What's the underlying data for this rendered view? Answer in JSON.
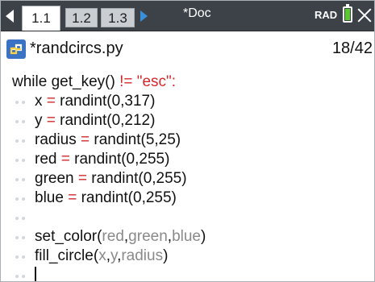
{
  "tabs": [
    {
      "label": "1.1",
      "active": true
    },
    {
      "label": "1.2",
      "active": false
    },
    {
      "label": "1.3",
      "active": false
    }
  ],
  "doc_title": "*Doc",
  "mode": "RAD",
  "file": {
    "name": "*randcircs.py",
    "position": "18/42"
  },
  "code": {
    "line1": {
      "kw": "while",
      "call": " get_key() ",
      "op": "!=",
      "str": " \"esc\":"
    },
    "line2": {
      "name": "x",
      "eq": " = ",
      "call": "randint(0,317)"
    },
    "line3": {
      "name": "y",
      "eq": " = ",
      "call": "randint(0,212)"
    },
    "line4": {
      "name": "radius",
      "eq": " = ",
      "call": "randint(5,25)"
    },
    "line5": {
      "name": "red",
      "eq": " = ",
      "call": "randint(0,255)"
    },
    "line6": {
      "name": "green",
      "eq": " = ",
      "call": "randint(0,255)"
    },
    "line7": {
      "name": "blue",
      "eq": " = ",
      "call": "randint(0,255)"
    },
    "line9": {
      "fn": "set_color(",
      "a": "red",
      "c1": ",",
      "b": "green",
      "c2": ",",
      "c": "blue",
      "end": ")"
    },
    "line10": {
      "fn": "fill_circle(",
      "a": "x",
      "c1": ",",
      "b": "y",
      "c2": ",",
      "c": "radius",
      "end": ")"
    }
  },
  "colors": {
    "topbar": "#3d4248",
    "string": "#d1282c",
    "variable_arg": "#8a8a8a",
    "battery": "#5cc934",
    "nav_arrow": "#3a8fd9"
  },
  "icons": [
    "nav-left-arrow",
    "nav-right-arrow",
    "battery-icon",
    "close-icon",
    "python-file-icon",
    "indent-dots-icon"
  ]
}
